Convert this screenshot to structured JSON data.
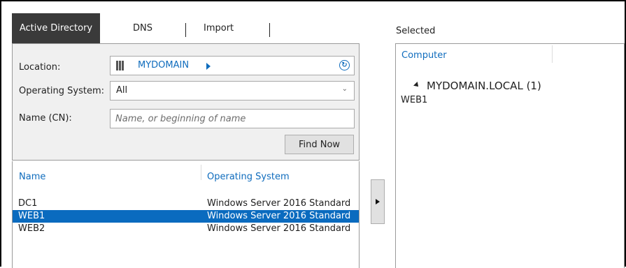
{
  "tabs": [
    {
      "label": "Active Directory",
      "active": true
    },
    {
      "label": "DNS",
      "active": false
    },
    {
      "label": "Import",
      "active": false
    }
  ],
  "search": {
    "location_label": "Location:",
    "location_value": "MYDOMAIN",
    "os_label": "Operating System:",
    "os_value": "All",
    "name_label": "Name (CN):",
    "name_placeholder": "Name, or beginning of name",
    "find_button": "Find Now"
  },
  "results": {
    "columns": [
      "Name",
      "Operating System"
    ],
    "rows": [
      {
        "name": "DC1",
        "os": "Windows Server 2016 Standard",
        "selected": false
      },
      {
        "name": "WEB1",
        "os": "Windows Server 2016 Standard",
        "selected": true
      },
      {
        "name": "WEB2",
        "os": "Windows Server 2016 Standard",
        "selected": false
      }
    ]
  },
  "selected_panel": {
    "title": "Selected",
    "column": "Computer",
    "group": "MYDOMAIN.LOCAL (1)",
    "items": [
      "WEB1"
    ]
  },
  "colors": {
    "accent": "#0f6cbd",
    "selection": "#0a6bbf",
    "active_tab": "#3a3a3a"
  },
  "icons": {
    "location": "domain-icon",
    "refresh": "refresh-icon",
    "add": "play-arrow-icon"
  }
}
